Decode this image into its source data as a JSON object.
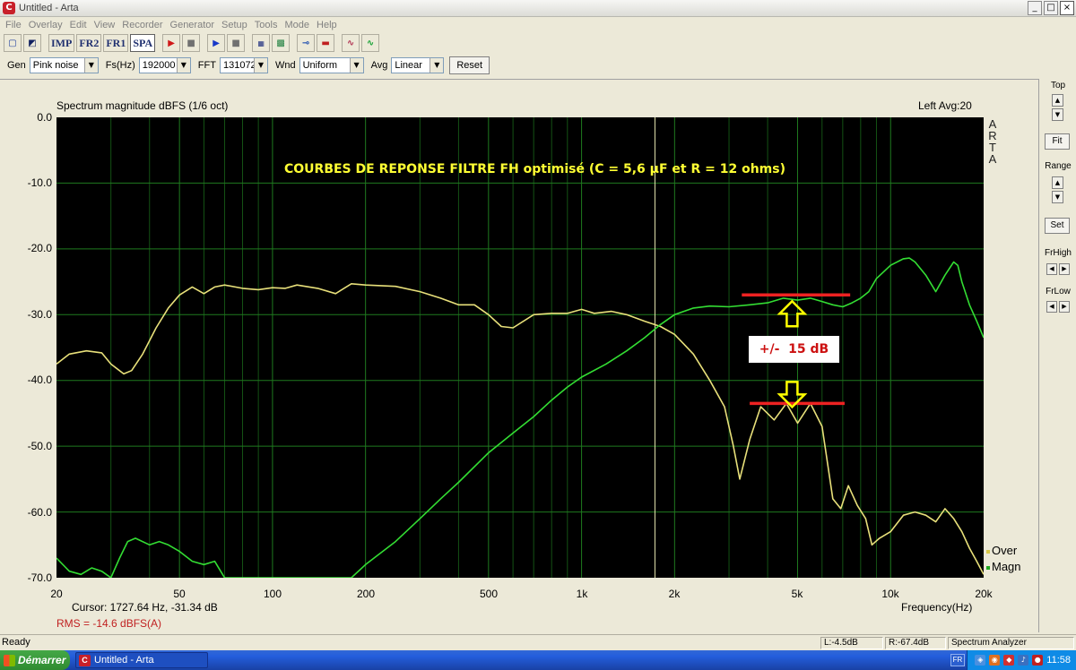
{
  "window": {
    "title": "Untitled - Arta",
    "app_icon": "arta-app-icon",
    "min": "_",
    "max": "□",
    "close": "×"
  },
  "menu": [
    "File",
    "Overlay",
    "Edit",
    "View",
    "Recorder",
    "Generator",
    "Setup",
    "Tools",
    "Mode",
    "Help"
  ],
  "toolbar": {
    "imp": "IMP",
    "fr2": "FR2",
    "fr1": "FR1",
    "spa": "SPA"
  },
  "settings": {
    "gen_label": "Gen",
    "gen_value": "Pink noise",
    "fs_label": "Fs(Hz)",
    "fs_value": "192000",
    "fft_label": "FFT",
    "fft_value": "131072",
    "wnd_label": "Wnd",
    "wnd_value": "Uniform",
    "avg_label": "Avg",
    "avg_value": "Linear",
    "reset_label": "Reset"
  },
  "graph": {
    "header_left": "Spectrum magnitude dBFS (1/6 oct)",
    "header_right": "Left  Avg:20",
    "brand_vertical": [
      "A",
      "R",
      "T",
      "A"
    ],
    "cursor_text": "Cursor:  1727.64 Hz, -31.34 dB",
    "rms_text": "RMS =  -14.6 dBFS(A)",
    "annotation_title": "COURBES DE REPONSE FILTRE FH optimisé (C = 5,6 µF et R = 12 ohms)",
    "annotation_box": "+/-  15 dB",
    "legend": [
      {
        "name": "Over",
        "color": "#e8e07a"
      },
      {
        "name": "Magn",
        "color": "#33dd33"
      }
    ]
  },
  "chart_data": {
    "type": "line",
    "title": "Spectrum magnitude dBFS (1/6 oct)",
    "xlabel": "Frequency(Hz)",
    "ylabel": "",
    "x_scale": "log",
    "xlim": [
      20,
      20000
    ],
    "ylim": [
      -70,
      0
    ],
    "grid": true,
    "legend_position": "bottom-right",
    "x_ticks": [
      {
        "value": 20,
        "label": "20"
      },
      {
        "value": 50,
        "label": "50"
      },
      {
        "value": 100,
        "label": "100"
      },
      {
        "value": 200,
        "label": "200"
      },
      {
        "value": 500,
        "label": "500"
      },
      {
        "value": 1000,
        "label": "1k"
      },
      {
        "value": 2000,
        "label": "2k"
      },
      {
        "value": 5000,
        "label": "5k"
      },
      {
        "value": 10000,
        "label": "10k"
      },
      {
        "value": 20000,
        "label": "20k"
      }
    ],
    "y_ticks": [
      {
        "value": 0,
        "label": "0.0"
      },
      {
        "value": -10,
        "label": "-10.0"
      },
      {
        "value": -20,
        "label": "-20.0"
      },
      {
        "value": -30,
        "label": "-30.0"
      },
      {
        "value": -40,
        "label": "-40.0"
      },
      {
        "value": -50,
        "label": "-50.0"
      },
      {
        "value": -60,
        "label": "-60.0"
      },
      {
        "value": -70,
        "label": "-70.0"
      }
    ],
    "cursor_hz": 1727.64,
    "series": [
      {
        "name": "Over",
        "color": "#e8e07a",
        "points": [
          [
            20,
            -37.5
          ],
          [
            22,
            -36
          ],
          [
            25,
            -35.5
          ],
          [
            28,
            -35.8
          ],
          [
            30,
            -37.5
          ],
          [
            33,
            -39
          ],
          [
            35,
            -38.5
          ],
          [
            38,
            -36
          ],
          [
            42,
            -32
          ],
          [
            46,
            -29
          ],
          [
            50,
            -27
          ],
          [
            55,
            -25.8
          ],
          [
            60,
            -26.8
          ],
          [
            65,
            -25.8
          ],
          [
            70,
            -25.5
          ],
          [
            80,
            -26
          ],
          [
            90,
            -26.2
          ],
          [
            100,
            -25.9
          ],
          [
            110,
            -26
          ],
          [
            120,
            -25.5
          ],
          [
            140,
            -26
          ],
          [
            160,
            -26.8
          ],
          [
            180,
            -25.3
          ],
          [
            200,
            -25.5
          ],
          [
            250,
            -25.7
          ],
          [
            300,
            -26.5
          ],
          [
            350,
            -27.5
          ],
          [
            400,
            -28.5
          ],
          [
            450,
            -28.5
          ],
          [
            500,
            -30
          ],
          [
            550,
            -31.8
          ],
          [
            600,
            -32
          ],
          [
            700,
            -30
          ],
          [
            800,
            -29.8
          ],
          [
            900,
            -29.8
          ],
          [
            1000,
            -29.2
          ],
          [
            1100,
            -29.8
          ],
          [
            1250,
            -29.5
          ],
          [
            1400,
            -30
          ],
          [
            1600,
            -31
          ],
          [
            1800,
            -31.8
          ],
          [
            2000,
            -33
          ],
          [
            2300,
            -36
          ],
          [
            2600,
            -40
          ],
          [
            2900,
            -44
          ],
          [
            3100,
            -50
          ],
          [
            3250,
            -55
          ],
          [
            3500,
            -49
          ],
          [
            3800,
            -44
          ],
          [
            4200,
            -46
          ],
          [
            4600,
            -43.5
          ],
          [
            5000,
            -46.5
          ],
          [
            5500,
            -43.5
          ],
          [
            6000,
            -47
          ],
          [
            6500,
            -58
          ],
          [
            6900,
            -59.5
          ],
          [
            7300,
            -56
          ],
          [
            7800,
            -59
          ],
          [
            8300,
            -61
          ],
          [
            8700,
            -65
          ],
          [
            9200,
            -64
          ],
          [
            10000,
            -63
          ],
          [
            11000,
            -60.5
          ],
          [
            12000,
            -60
          ],
          [
            13000,
            -60.5
          ],
          [
            14000,
            -61.5
          ],
          [
            15000,
            -59.5
          ],
          [
            16000,
            -61
          ],
          [
            17000,
            -63
          ],
          [
            18000,
            -65.5
          ],
          [
            19000,
            -67.5
          ],
          [
            20000,
            -69.5
          ]
        ]
      },
      {
        "name": "Magn",
        "color": "#33dd33",
        "points": [
          [
            20,
            -67
          ],
          [
            22,
            -69
          ],
          [
            24,
            -69.5
          ],
          [
            26,
            -68.5
          ],
          [
            28,
            -69
          ],
          [
            30,
            -70
          ],
          [
            32,
            -67
          ],
          [
            34,
            -64.5
          ],
          [
            36,
            -64
          ],
          [
            40,
            -65
          ],
          [
            43,
            -64.5
          ],
          [
            46,
            -65
          ],
          [
            50,
            -66
          ],
          [
            55,
            -67.5
          ],
          [
            60,
            -68
          ],
          [
            65,
            -67.5
          ],
          [
            70,
            -70
          ],
          [
            180,
            -70
          ],
          [
            200,
            -68
          ],
          [
            250,
            -64.5
          ],
          [
            300,
            -61
          ],
          [
            350,
            -58
          ],
          [
            400,
            -55.5
          ],
          [
            500,
            -51
          ],
          [
            600,
            -48
          ],
          [
            700,
            -45.5
          ],
          [
            800,
            -43
          ],
          [
            900,
            -41
          ],
          [
            1000,
            -39.5
          ],
          [
            1200,
            -37.5
          ],
          [
            1400,
            -35.5
          ],
          [
            1600,
            -33.5
          ],
          [
            1800,
            -31.5
          ],
          [
            2000,
            -30
          ],
          [
            2300,
            -29
          ],
          [
            2600,
            -28.7
          ],
          [
            3000,
            -28.8
          ],
          [
            3500,
            -28.5
          ],
          [
            4000,
            -28.2
          ],
          [
            4500,
            -27.5
          ],
          [
            5000,
            -27.8
          ],
          [
            5500,
            -27.5
          ],
          [
            6000,
            -28
          ],
          [
            6500,
            -28.5
          ],
          [
            7000,
            -28.8
          ],
          [
            7500,
            -28.2
          ],
          [
            8000,
            -27.5
          ],
          [
            8500,
            -26.5
          ],
          [
            9000,
            -24.5
          ],
          [
            10000,
            -22.5
          ],
          [
            11000,
            -21.5
          ],
          [
            11500,
            -21.4
          ],
          [
            12000,
            -22
          ],
          [
            13000,
            -24
          ],
          [
            14000,
            -26.5
          ],
          [
            15000,
            -24
          ],
          [
            16000,
            -22
          ],
          [
            16500,
            -22.5
          ],
          [
            17000,
            -25
          ],
          [
            18000,
            -28.5
          ],
          [
            19000,
            -31
          ],
          [
            20000,
            -33.5
          ]
        ]
      }
    ],
    "overlay_lines": [
      {
        "y": -27,
        "x_from": 3300,
        "x_to": 7400,
        "color": "#ee2222"
      },
      {
        "y": -43.5,
        "x_from": 3500,
        "x_to": 7100,
        "color": "#ee2222"
      }
    ],
    "overlay_arrows": [
      {
        "direction": "up",
        "x": 4800,
        "y": -30,
        "color": "#ffff00"
      },
      {
        "direction": "down",
        "x": 4800,
        "y": -42,
        "color": "#ffff00"
      }
    ]
  },
  "sidepanel": {
    "top_label": "Top",
    "fit_label": "Fit",
    "range_label": "Range",
    "set_label": "Set",
    "frhigh_label": "FrHigh",
    "frlow_label": "FrLow"
  },
  "status": {
    "ready": "Ready",
    "l_value": "L:-4.5dB",
    "r_value": "R:-67.4dB",
    "mode": "Spectrum Analyzer"
  },
  "taskbar": {
    "start": "Démarrer",
    "task": "Untitled - Arta",
    "lang": "FR",
    "clock": "11:58"
  }
}
